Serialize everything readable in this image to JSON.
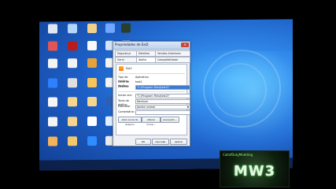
{
  "dialog": {
    "title": "Propriedades de Ext2",
    "close_label": "✕",
    "app_name": "Ext2",
    "tabs": [
      "Segurança",
      "Detalhes",
      "Versões Anteriores",
      "Geral",
      "Atalho",
      "Compatibilidade"
    ],
    "fields": {
      "type_label": "Tipo de destino:",
      "type_value": "Aplicativo",
      "location_label": "Local de destino:",
      "location_value": "test2",
      "target_label": "Destino:",
      "target_value": "\"C:\\Program Files\\test2\\\"",
      "start_in_label": "Iniciar em:",
      "start_in_value": "\"C:\\Program Files\\test2\\\"",
      "shortcut_label": "Tecla de atalho:",
      "shortcut_value": "Nenhum",
      "run_label": "Executar:",
      "run_value": "Janela normal",
      "comment_label": "Comentário:"
    },
    "buttons": [
      "Abrir Local do Arquivo",
      "Alterar Ícone...",
      "Avançado..."
    ],
    "footer_buttons": [
      "OK",
      "Cancelar",
      "Aplicar"
    ]
  },
  "logo": {
    "title": "CallofDutyModding",
    "text": "MW3"
  }
}
